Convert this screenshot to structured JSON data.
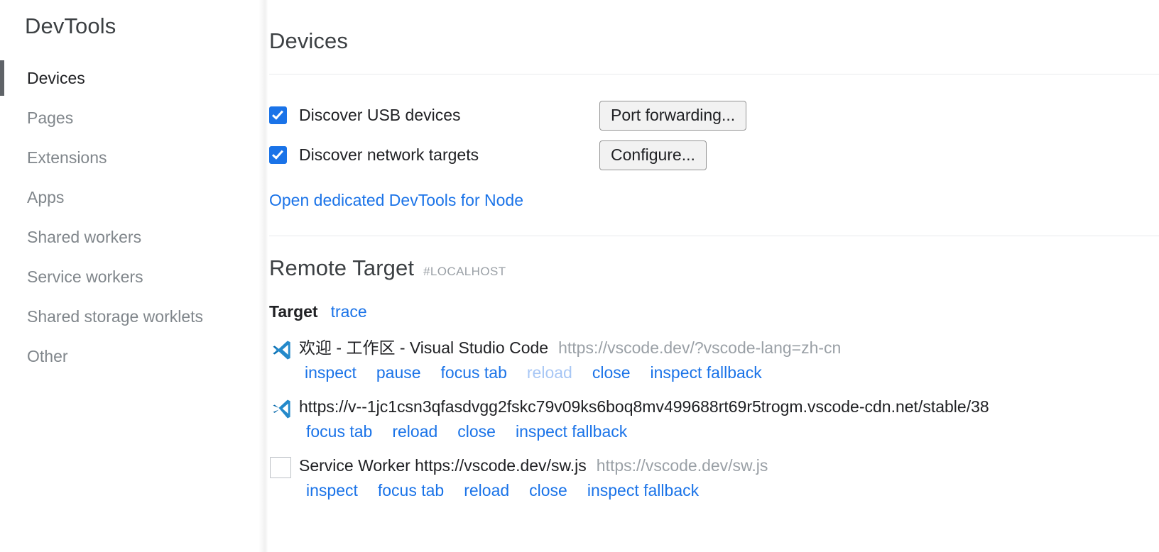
{
  "sidebar": {
    "title": "DevTools",
    "items": [
      {
        "label": "Devices",
        "selected": true
      },
      {
        "label": "Pages",
        "selected": false
      },
      {
        "label": "Extensions",
        "selected": false
      },
      {
        "label": "Apps",
        "selected": false
      },
      {
        "label": "Shared workers",
        "selected": false
      },
      {
        "label": "Service workers",
        "selected": false
      },
      {
        "label": "Shared storage worklets",
        "selected": false
      },
      {
        "label": "Other",
        "selected": false
      }
    ]
  },
  "main": {
    "page_title": "Devices",
    "discovery": {
      "usb": {
        "label": "Discover USB devices",
        "checked": true,
        "button": "Port forwarding..."
      },
      "network": {
        "label": "Discover network targets",
        "checked": true,
        "button": "Configure..."
      },
      "node_link": "Open dedicated DevTools for Node"
    },
    "remote_target": {
      "title": "Remote Target",
      "host": "#LOCALHOST",
      "target_label": "Target",
      "trace_label": "trace",
      "rows": [
        {
          "icon": "vscode-icon",
          "name": "欢迎 - 工作区 - Visual Studio Code",
          "url": "https://vscode.dev/?vscode-lang=zh-cn",
          "actions": [
            {
              "label": "inspect",
              "disabled": false
            },
            {
              "label": "pause",
              "disabled": false
            },
            {
              "label": "focus tab",
              "disabled": false
            },
            {
              "label": "reload",
              "disabled": true
            },
            {
              "label": "close",
              "disabled": false
            },
            {
              "label": "inspect fallback",
              "disabled": false
            }
          ]
        },
        {
          "icon": "vscode-icon",
          "name": "",
          "url": "https://v--1jc1csn3qfasdvgg2fskc79v09ks6boq8mv499688rt69r5trogm.vscode-cdn.net/stable/38",
          "actions": [
            {
              "label": "focus tab",
              "disabled": false
            },
            {
              "label": "reload",
              "disabled": false
            },
            {
              "label": "close",
              "disabled": false
            },
            {
              "label": "inspect fallback",
              "disabled": false
            }
          ]
        },
        {
          "icon": "blank-box-icon",
          "name": "Service Worker https://vscode.dev/sw.js",
          "url": "https://vscode.dev/sw.js",
          "actions": [
            {
              "label": "inspect",
              "disabled": false
            },
            {
              "label": "focus tab",
              "disabled": false
            },
            {
              "label": "reload",
              "disabled": false
            },
            {
              "label": "close",
              "disabled": false
            },
            {
              "label": "inspect fallback",
              "disabled": false
            }
          ]
        }
      ]
    }
  },
  "colors": {
    "link": "#1a73e8",
    "link_disabled": "#a8c7f5",
    "checkbox": "#1a73e8",
    "text_primary": "#202124",
    "text_muted": "#9aa0a6",
    "selected_bar": "#5f6368"
  }
}
